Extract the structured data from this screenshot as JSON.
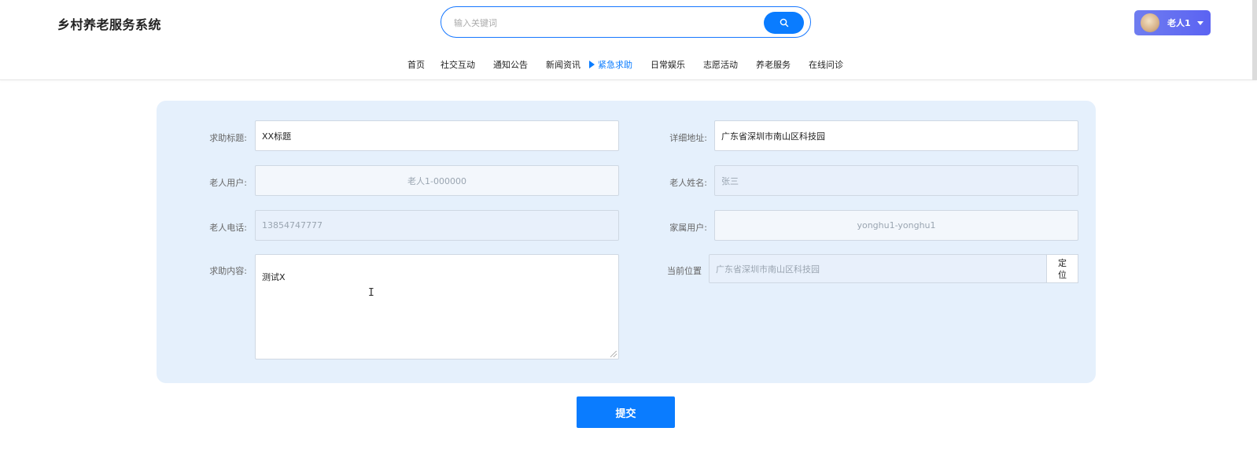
{
  "header": {
    "site_title": "乡村养老服务系统",
    "search_placeholder": "输入关键词",
    "user_name": "老人1"
  },
  "nav": {
    "items": [
      "首页",
      "社交互动",
      "通知公告",
      "新闻资讯",
      "紧急求助",
      "日常娱乐",
      "志愿活动",
      "养老服务",
      "在线问诊"
    ],
    "active": "紧急求助"
  },
  "form": {
    "title_label": "求助标题:",
    "title_value": "XX标题",
    "address_label": "详细地址:",
    "address_value": "广东省深圳市南山区科技园",
    "elder_user_label": "老人用户:",
    "elder_user_value": "老人1-000000",
    "elder_name_label": "老人姓名:",
    "elder_name_value": "张三",
    "elder_phone_label": "老人电话:",
    "elder_phone_value": "13854747777",
    "family_user_label": "家属用户:",
    "family_user_value": "yonghu1-yonghu1",
    "content_label": "求助内容:",
    "content_value": "测试X",
    "location_label": "当前位置",
    "location_value": "广东省深圳市南山区科技园",
    "locate_button": "定位",
    "submit_button": "提交"
  },
  "colors": {
    "primary": "#0a7cff",
    "panel_bg": "#e5f0fc"
  }
}
